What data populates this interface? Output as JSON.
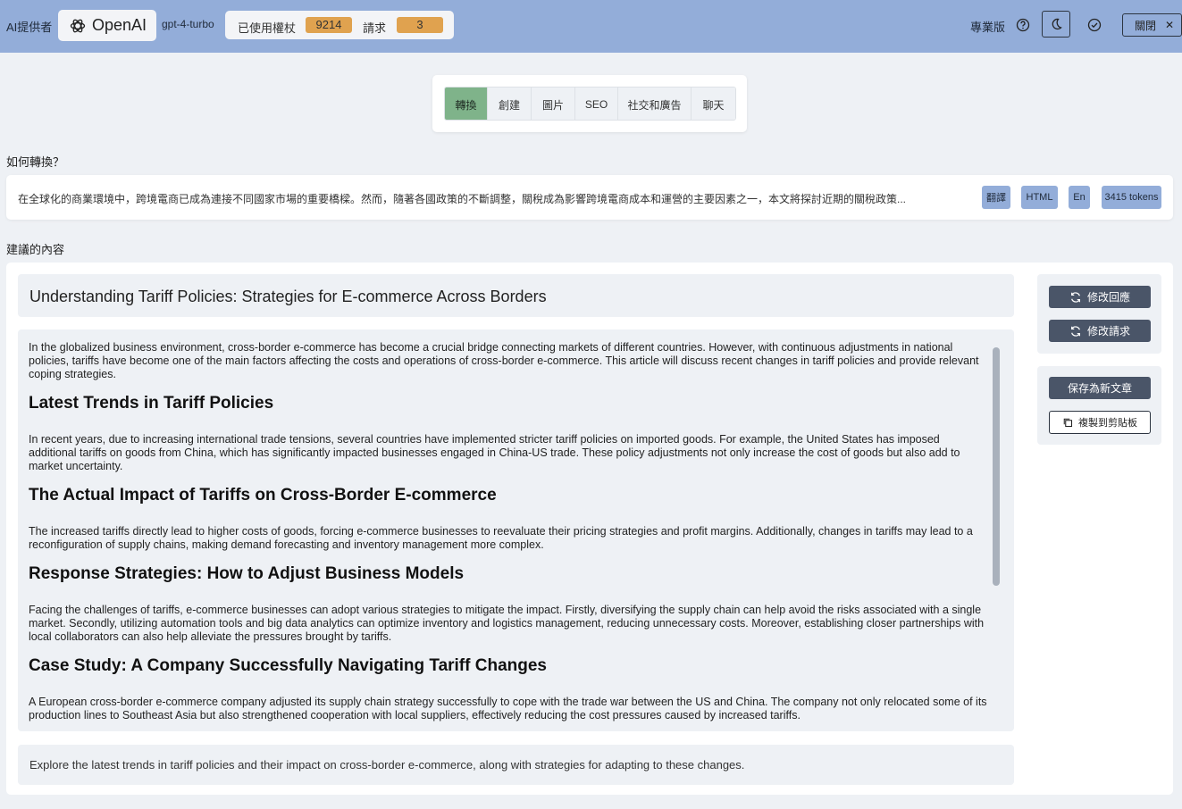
{
  "header": {
    "provider_label": "AI提供者",
    "provider_name": "OpenAI",
    "model": "gpt-4-turbo",
    "used_tokens_label": "已使用權杖",
    "used_tokens_value": "9214",
    "requests_label": "請求",
    "requests_value": "3",
    "plan_label": "專業版",
    "close_label": "關閉"
  },
  "tabs": [
    {
      "label": "轉換",
      "active": true
    },
    {
      "label": "創建",
      "active": false
    },
    {
      "label": "圖片",
      "active": false
    },
    {
      "label": "SEO",
      "active": false
    },
    {
      "label": "社交和廣告",
      "active": false
    },
    {
      "label": "聊天",
      "active": false
    }
  ],
  "input_section": {
    "label": "如何轉換？",
    "text": "在全球化的商業環境中，跨境電商已成為連接不同國家市場的重要橋樑。然而，隨著各國政策的不斷調整，關稅成為影響跨境電商成本和運營的主要因素之一，本文將探討近期的關稅政策...",
    "pills": [
      "翻譯",
      "HTML",
      "En",
      "3415 tokens"
    ]
  },
  "result_section": {
    "label": "建議的內容",
    "title": "Understanding Tariff Policies: Strategies for E-commerce Across Borders",
    "intro": "In the globalized business environment, cross-border e-commerce has become a crucial bridge connecting markets of different countries. However, with continuous adjustments in national policies, tariffs have become one of the main factors affecting the costs and operations of cross-border e-commerce. This article will discuss recent changes in tariff policies and provide relevant coping strategies.",
    "sections": [
      {
        "heading": "Latest Trends in Tariff Policies",
        "body": "In recent years, due to increasing international trade tensions, several countries have implemented stricter tariff policies on imported goods. For example, the United States has imposed additional tariffs on goods from China, which has significantly impacted businesses engaged in China-US trade. These policy adjustments not only increase the cost of goods but also add to market uncertainty."
      },
      {
        "heading": "The Actual Impact of Tariffs on Cross-Border E-commerce",
        "body": "The increased tariffs directly lead to higher costs of goods, forcing e-commerce businesses to reevaluate their pricing strategies and profit margins. Additionally, changes in tariffs may lead to a reconfiguration of supply chains, making demand forecasting and inventory management more complex."
      },
      {
        "heading": "Response Strategies: How to Adjust Business Models",
        "body": "Facing the challenges of tariffs, e-commerce businesses can adopt various strategies to mitigate the impact. Firstly, diversifying the supply chain can help avoid the risks associated with a single market. Secondly, utilizing automation tools and big data analytics can optimize inventory and logistics management, reducing unnecessary costs. Moreover, establishing closer partnerships with local collaborators can also help alleviate the pressures brought by tariffs."
      },
      {
        "heading": "Case Study: A Company Successfully Navigating Tariff Changes",
        "body": "A European cross-border e-commerce company adjusted its supply chain strategy successfully to cope with the trade war between the US and China. The company not only relocated some of its production lines to Southeast Asia but also strengthened cooperation with local suppliers, effectively reducing the cost pressures caused by increased tariffs."
      }
    ],
    "meta_description": "Explore the latest trends in tariff policies and their impact on cross-border e-commerce, along with strategies for adapting to these changes."
  },
  "actions": {
    "modify_response": "修改回應",
    "modify_request": "修改請求",
    "save_as_new": "保存為新文章",
    "copy_clipboard": "複製到剪貼板"
  }
}
